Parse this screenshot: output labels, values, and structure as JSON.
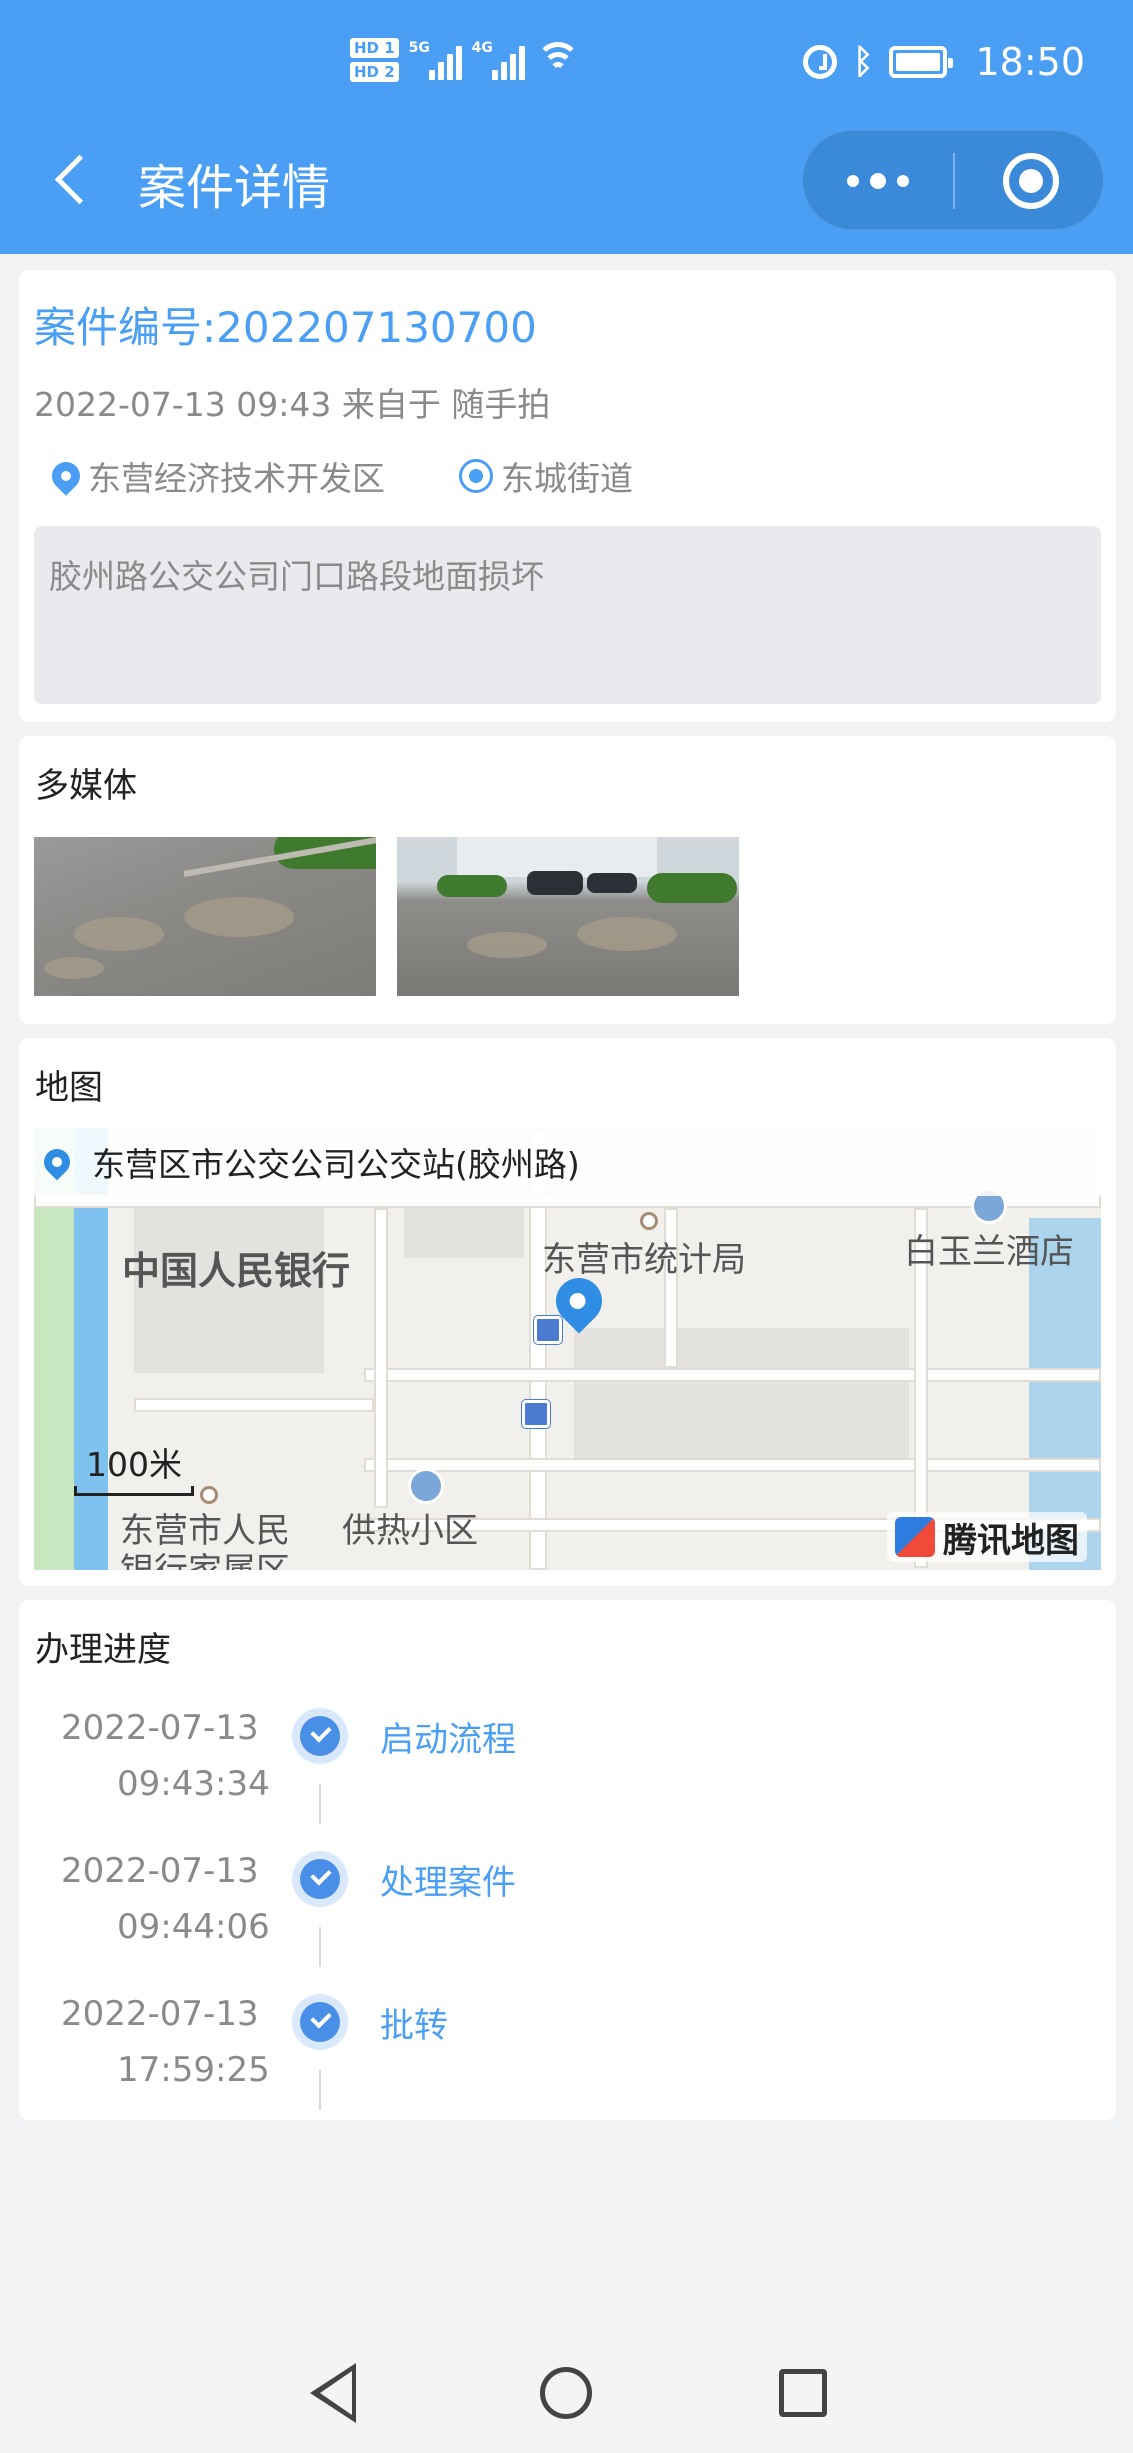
{
  "status_bar": {
    "sim1": "HD 1",
    "sim2": "HD 2",
    "net1": "5G",
    "net2": "4G",
    "time": "18:50",
    "icons": [
      "alarm-icon",
      "bluetooth-icon",
      "battery-icon",
      "wifi-icon"
    ]
  },
  "nav": {
    "title": "案件详情",
    "back_icon": "back-chevron-icon",
    "more_icon": "more-dots-icon",
    "close_icon": "close-target-icon"
  },
  "case": {
    "number": "案件编号:202207130700",
    "meta": "2022-07-13 09:43 来自于 随手拍",
    "district": "东营经济技术开发区",
    "street": "东城街道",
    "description": "胶州路公交公司门口路段地面损坏"
  },
  "media": {
    "title": "多媒体",
    "photos": [
      "pothole-photo",
      "street-photo"
    ]
  },
  "map": {
    "title": "地图",
    "address": "东营区市公交公司公交站(胶州路)",
    "places": {
      "bank": "中国人民银行",
      "stats": "东营市统计局",
      "hotel": "白玉兰酒店",
      "community": "供热小区",
      "residence_line1": "东营市人民",
      "residence_line2": "银行家属区"
    },
    "scale": "100米",
    "brand": "腾讯地图"
  },
  "progress": {
    "title": "办理进度",
    "steps": [
      {
        "date": "2022-07-13",
        "time": "09:43:34",
        "label": "启动流程"
      },
      {
        "date": "2022-07-13",
        "time": "09:44:06",
        "label": "处理案件"
      },
      {
        "date": "2022-07-13",
        "time": "17:59:25",
        "label": "批转"
      }
    ]
  },
  "colors": {
    "header": "#4a9ff5",
    "accent": "#4a9ff5",
    "background": "#f1f2f4"
  }
}
